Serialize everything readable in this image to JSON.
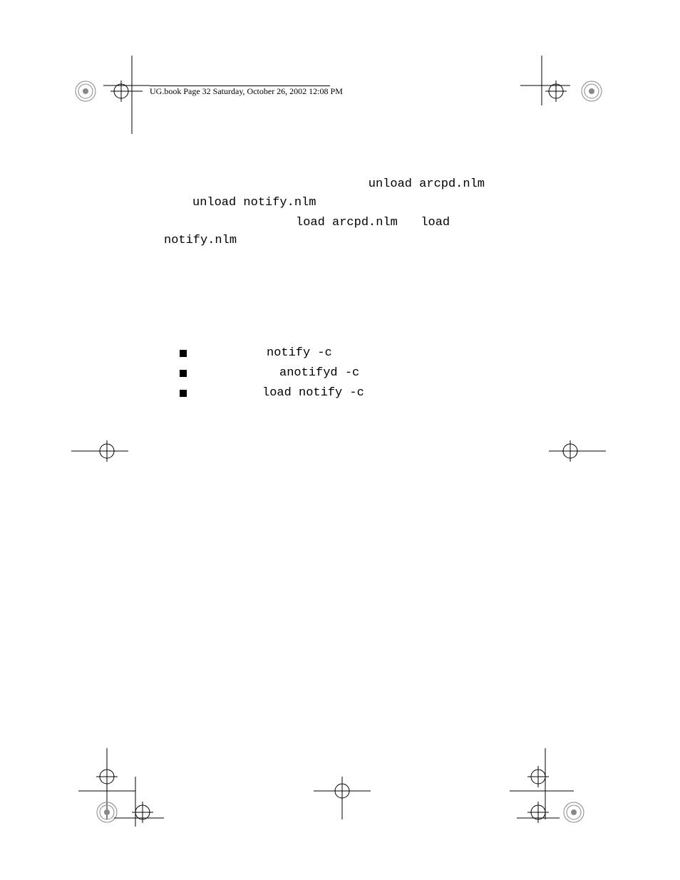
{
  "header": {
    "text": "UG.book  Page 32  Saturday, October 26, 2002  12:08 PM"
  },
  "body": {
    "line1_mono": "unload arcpd.nlm",
    "line2_mono": "unload notify.nlm",
    "line3_mono_a": "load arcpd.nlm",
    "line3_mono_b": "load",
    "line4_mono": "notify.nlm"
  },
  "bullets": [
    {
      "cmd": "notify -c"
    },
    {
      "cmd": "anotifyd -c"
    },
    {
      "cmd": "load notify -c"
    }
  ]
}
